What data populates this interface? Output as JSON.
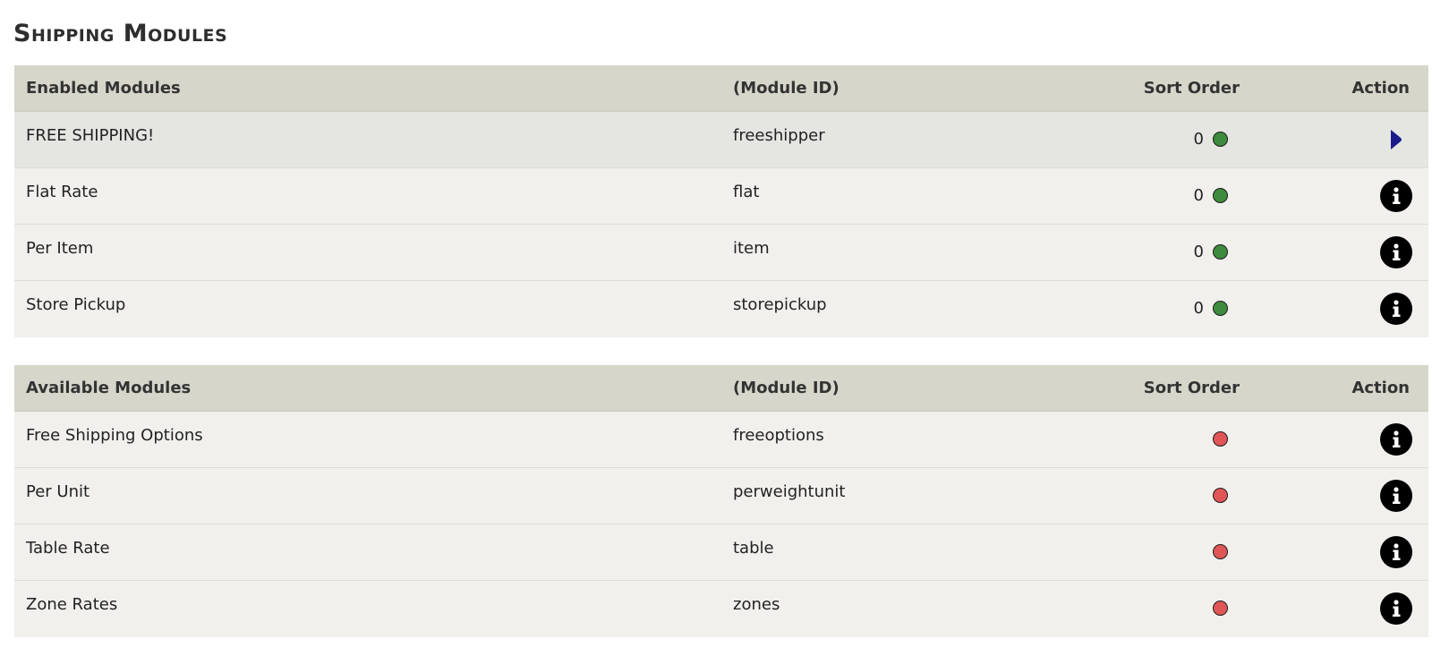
{
  "page": {
    "title": "Shipping Modules"
  },
  "enabled": {
    "headers": {
      "name": "Enabled Modules",
      "id": "(Module ID)",
      "sort": "Sort Order",
      "action": "Action"
    },
    "rows": [
      {
        "name": "FREE SHIPPING!",
        "id": "freeshipper",
        "sort": "0",
        "status": "enabled",
        "action_icon": "arrow-right-icon"
      },
      {
        "name": "Flat Rate",
        "id": "flat",
        "sort": "0",
        "status": "enabled",
        "action_icon": "info-icon"
      },
      {
        "name": "Per Item",
        "id": "item",
        "sort": "0",
        "status": "enabled",
        "action_icon": "info-icon"
      },
      {
        "name": "Store Pickup",
        "id": "storepickup",
        "sort": "0",
        "status": "enabled",
        "action_icon": "info-icon"
      }
    ]
  },
  "available": {
    "headers": {
      "name": "Available Modules",
      "id": "(Module ID)",
      "sort": "Sort Order",
      "action": "Action"
    },
    "rows": [
      {
        "name": "Free Shipping Options",
        "id": "freeoptions",
        "sort": "",
        "status": "disabled",
        "action_icon": "info-icon"
      },
      {
        "name": "Per Unit",
        "id": "perweightunit",
        "sort": "",
        "status": "disabled",
        "action_icon": "info-icon"
      },
      {
        "name": "Table Rate",
        "id": "table",
        "sort": "",
        "status": "disabled",
        "action_icon": "info-icon"
      },
      {
        "name": "Zone Rates",
        "id": "zones",
        "sort": "",
        "status": "disabled",
        "action_icon": "info-icon"
      }
    ]
  },
  "colors": {
    "header_bg": "#d6d6cb",
    "row_bg": "#f1f0ed",
    "row_highlight_bg": "#e5e5e1",
    "status_enabled": "#3e8a3e",
    "status_disabled": "#e05656",
    "arrow_icon": "#1a1a8c"
  }
}
